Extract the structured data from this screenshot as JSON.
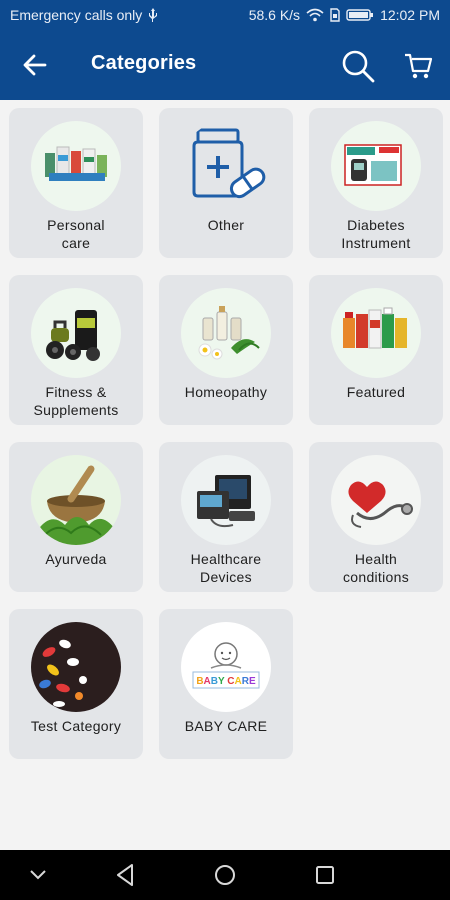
{
  "status_bar": {
    "left_text": "Emergency calls only",
    "network_speed": "58.6 K/s",
    "time": "12:02 PM"
  },
  "header": {
    "title": "Categories",
    "background_color": "#0d4a8f"
  },
  "categories": [
    {
      "label": "Personal\ncare",
      "icon": "personal-care-image"
    },
    {
      "label": "Other",
      "icon": "medicine-bottle-icon"
    },
    {
      "label": "Diabetes\nInstrument",
      "icon": "glucometer-image"
    },
    {
      "label": "Fitness &\nSupplements",
      "icon": "supplements-image"
    },
    {
      "label": "Homeopathy",
      "icon": "herbal-flowers-image"
    },
    {
      "label": "Featured",
      "icon": "featured-products-image"
    },
    {
      "label": "Ayurveda",
      "icon": "mortar-herbs-image"
    },
    {
      "label": "Healthcare\nDevices",
      "icon": "medical-device-image"
    },
    {
      "label": "Health\nconditions",
      "icon": "heart-stethoscope-image"
    },
    {
      "label": "Test Category",
      "icon": "pills-image"
    },
    {
      "label": "BABY CARE",
      "icon": "baby-care-logo",
      "logo_text": "BABY CARE"
    }
  ]
}
